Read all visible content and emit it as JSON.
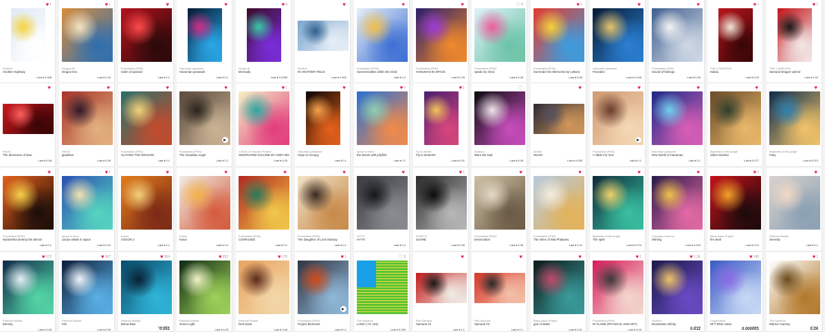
{
  "rows": [
    {
      "cards": [
        {
          "creator": "Another",
          "title": "Another Highway",
          "price": "Last ♦ 0.008",
          "likes": "1",
          "c1": "#dfe9f5",
          "c2": "#ffffff",
          "c3": "#f4d33f",
          "shape": "portrait"
        },
        {
          "creator": "Dragon Art",
          "title": "Dragon Era",
          "price": "Last ♦ 0.18",
          "likes": "1",
          "c1": "#d98c3b",
          "c2": "#2f6fb0",
          "c3": "#f4e3c2",
          "shape": "square"
        },
        {
          "creator": "Foundation (PHD)",
          "title": "realm of passion",
          "price": "Last ♦ 0.1",
          "likes": "",
          "c1": "#b3121d",
          "c2": "#2a0a0a",
          "c3": "#ff4b4b",
          "shape": "square"
        },
        {
          "creator": "Hanuman panasant",
          "title": "Hanuman panasant",
          "price": "Last ♦ 0.1",
          "likes": "",
          "c1": "#071a33",
          "c2": "#2aa7e8",
          "c3": "#d12e8b",
          "shape": "portrait"
        },
        {
          "creator": "Oracle III",
          "title": "McGrady",
          "price": "Last ♦ 0.0289",
          "likes": "8",
          "c1": "#3a0d2b",
          "c2": "#7a2dd9",
          "c3": "#39c9a8",
          "shape": "portrait"
        },
        {
          "creator": "Another",
          "title": "IN ANOTHER FIELD",
          "price": "Last ♦ 0.002",
          "likes": "",
          "c1": "#7da7cf",
          "c2": "#e6eef6",
          "c3": "#2f5f8e",
          "shape": "landscape"
        },
        {
          "creator": "Foundation (PHD)",
          "title": "Summersalties within the mind",
          "price": "Last ♦ 0.2",
          "likes": "",
          "c1": "#e6eef8",
          "c2": "#3d6fd3",
          "c3": "#f2c04e",
          "shape": "square"
        },
        {
          "creator": "Foundation (PHD)",
          "title": "HANUMAN IN SPACE",
          "price": "Last ♦ 0.25",
          "likes": "",
          "c1": "#2b1e6b",
          "c2": "#f08a2b",
          "c3": "#9f3cd8",
          "shape": "square"
        },
        {
          "creator": "Foundation (PHD)",
          "title": "speak my mind",
          "price": "Last ♦ 0.05",
          "likes": "0",
          "c1": "#dff1f8",
          "c2": "#6bc3a6",
          "c3": "#e95d9a",
          "shape": "square",
          "emptyHeart": true
        },
        {
          "creator": "Foundation (PHD)",
          "title": "Surrender the Memories by LeBora",
          "price": "Last ♦ 0.05",
          "likes": "1",
          "c1": "#e63a2c",
          "c2": "#3b9de0",
          "c3": "#f5d23a",
          "shape": "square"
        },
        {
          "creator": "Hanuman panasant",
          "title": "Poseidon",
          "price": "Last ♦ 0.045",
          "likes": "",
          "c1": "#061a33",
          "c2": "#2b7fd3",
          "c3": "#e7c36a",
          "shape": "square"
        },
        {
          "creator": "Foundation (PHD)",
          "title": "Sound of feelings",
          "price": "Last ♦ 0.05",
          "likes": "",
          "c1": "#3f5f8f",
          "c2": "#cfd8e6",
          "c3": "#f4f4f4",
          "shape": "square"
        },
        {
          "creator": "THE_LIVARGON",
          "title": "Kakau",
          "price": "Last ♦ 0.02",
          "likes": "1",
          "c1": "#b9151b",
          "c2": "#3a0608",
          "c3": "#f0e6d8",
          "shape": "portrait"
        },
        {
          "creator": "THE_LIVARGON",
          "title": "Samurai Dragon warrior",
          "price": "Last ♦ 0.02",
          "likes": "1",
          "c1": "#c4141a",
          "c2": "#f3e8e8",
          "c3": "#1a1a1a",
          "shape": "portrait"
        }
      ]
    },
    {
      "cards": [
        {
          "creator": "Hell III",
          "title": "The dimension of deer",
          "price": "Last ♦ 0.08",
          "likes": "",
          "c1": "#c8171c",
          "c2": "#3a0406",
          "c3": "#ff6060",
          "shape": "landscape"
        },
        {
          "creator": "Hell III",
          "title": "giantface",
          "price": "Last ♦ 0.08",
          "likes": "",
          "c1": "#a8342a",
          "c2": "#e2b07e",
          "c3": "#2f1a2a",
          "shape": "square"
        },
        {
          "creator": "Foundation (PHD)",
          "title": "SLAYING THE DRAGON",
          "price": "Last ♦ 0.1",
          "likes": "",
          "c1": "#2b6f6a",
          "c2": "#c24b2d",
          "c3": "#f1d27a",
          "shape": "square"
        },
        {
          "creator": "Foundation (PHD)",
          "title": "The Guardian Angel",
          "price": "Last ♦ 0.1",
          "likes": "",
          "c1": "#5a4a3c",
          "c2": "#cab394",
          "c3": "#2a221c",
          "shape": "square",
          "play": true
        },
        {
          "creator": "COVID-19 Vaccine Project",
          "title": "SINOPHARM VACCINE BY ANDY MOCKARO",
          "price": "Last ♦ 0.03",
          "likes": "1",
          "c1": "#f5f0c5",
          "c2": "#e23c7c",
          "c3": "#2aa7a0",
          "shape": "square"
        },
        {
          "creator": "Hanuman panasant",
          "title": "Hope to Occupy",
          "price": "Last ♦ 0.1",
          "likes": "",
          "c1": "#0b0503",
          "c2": "#e3611c",
          "c3": "#f7a24a",
          "shape": "portrait"
        },
        {
          "creator": "space in mind",
          "title": "the dream with jellyfish",
          "price": "Last ♦ 0.1",
          "likes": "0",
          "c1": "#2b6fd3",
          "c2": "#f08a4b",
          "c3": "#8ed0b3",
          "shape": "square"
        },
        {
          "creator": "Fly to dream",
          "title": "Fly to dream#2",
          "price": "Last ♦ 0.01",
          "likes": "1",
          "c1": "#4b1f6e",
          "c2": "#d6457d",
          "c3": "#f3c45a",
          "shape": "portrait"
        },
        {
          "creator": "Amazon",
          "title": "Warn Me Dad",
          "price": "Last ♦ 0.05",
          "likes": "",
          "c1": "#0b0b0f",
          "c2": "#c84dbd",
          "c3": "#f0e6ea",
          "shape": "square",
          "emptyHeart": true
        },
        {
          "creator": "OKAM",
          "title": "OKAM",
          "price": "Last ♦ 0.005",
          "likes": "",
          "c1": "#2c2a33",
          "c2": "#d1965a",
          "c3": "#554f5f",
          "shape": "landscape"
        },
        {
          "creator": "Foundation (PHD)",
          "title": "A Table For One",
          "price": "Last ♦ 0.1",
          "likes": "",
          "c1": "#cf9a73",
          "c2": "#f4d7b4",
          "c3": "#6a3b2a",
          "shape": "square",
          "play": true
        },
        {
          "creator": "Hanuman panasant",
          "title": "New World of Hanuman",
          "price": "Last ♦ 0.1",
          "likes": "",
          "c1": "#1b2b88",
          "c2": "#d95eb6",
          "c3": "#6fd0ef",
          "shape": "square"
        },
        {
          "creator": "Mysteries of the jungle",
          "title": "Silent Gazebo",
          "price": "Last ♦ 0.077",
          "likes": "",
          "c1": "#6a4b2a",
          "c2": "#e9b76a",
          "c3": "#2f3f2b",
          "shape": "square"
        },
        {
          "creator": "Mysteries of the jungle",
          "title": "Fairy",
          "price": "Last ♦ 0.074",
          "likes": "",
          "c1": "#0d2b4b",
          "c2": "#f2c46a",
          "c3": "#2f7fb0",
          "shape": "square"
        }
      ]
    },
    {
      "cards": [
        {
          "creator": "Foundation (PHD)",
          "title": "Narasimha destroy the demon",
          "price": "Last ♦ 0.1",
          "likes": "",
          "c1": "#e6601c",
          "c2": "#1b0d08",
          "c3": "#f7d14a",
          "shape": "square"
        },
        {
          "creator": "space in mind",
          "title": "cactus whale in space",
          "price": "Last ♦ 0.10",
          "likes": "1",
          "c1": "#2b4fb3",
          "c2": "#55d5c0",
          "c3": "#f3e2b0",
          "shape": "square"
        },
        {
          "creator": "Kasso",
          "title": "AGGON 2",
          "price": "Last ♦ 0.1",
          "likes": "",
          "c1": "#e37b1c",
          "c2": "#7a2a16",
          "c3": "#f3d07a",
          "shape": "square"
        },
        {
          "creator": "Kasso",
          "title": "Kasoi",
          "price": "Last ♦ 0.2",
          "likes": "",
          "c1": "#f0ece4",
          "c2": "#d45a3c",
          "c3": "#f2b34a",
          "shape": "square"
        },
        {
          "creator": "Foundation (PHD)",
          "title": "CONFUSED",
          "price": "Last ♦ 0.1",
          "likes": "",
          "c1": "#b4261e",
          "c2": "#f1c84a",
          "c3": "#2a7a5a",
          "shape": "square"
        },
        {
          "creator": "Foundation (PHD)",
          "title": "The Daughter of Lord Varanay",
          "price": "Last ♦ 0.1",
          "likes": "",
          "c1": "#f0e2c6",
          "c2": "#c88a4a",
          "c3": "#3a2a22",
          "shape": "square"
        },
        {
          "creator": "HYTH",
          "title": "HYTH",
          "price": "Last ♦ 0.2",
          "likes": "",
          "c1": "#3a3b40",
          "c2": "#8a8c92",
          "c3": "#16171a",
          "shape": "square"
        },
        {
          "creator": "SUAR VI",
          "title": "SUARE",
          "price": "Last ♦ 0.05",
          "likes": "1",
          "c1": "#2b2b2b",
          "c2": "#b8b8b8",
          "c3": "#0c0c0c",
          "shape": "square"
        },
        {
          "creator": "Foundation (PHD)",
          "title": "Desecration",
          "price": "Last ♦ 0.35",
          "likes": "",
          "c1": "#cdbfa4",
          "c2": "#6a5a44",
          "c3": "#e4d9c6",
          "shape": "square"
        },
        {
          "creator": "Foundation (PHD)",
          "title": "The shine of Wat Phakaew",
          "price": "Last ♦ 0.11",
          "likes": "",
          "c1": "#b7c9dc",
          "c2": "#e3b25a",
          "c3": "#f4ede0",
          "shape": "square"
        },
        {
          "creator": "Mysteries of the jungle",
          "title": "The spirit",
          "price": "Last ♦ 0.074",
          "likes": "",
          "c1": "#0c2a3a",
          "c2": "#3ac0a0",
          "c3": "#f1d36a",
          "shape": "square"
        },
        {
          "creator": "Compass Cosmos",
          "title": "Shining",
          "price": "Last ♦ 0.013",
          "likes": "",
          "c1": "#2a1a4b",
          "c2": "#e46aa6",
          "c3": "#f0c24a",
          "shape": "square"
        },
        {
          "creator": "Black Asian Project",
          "title": "fire devil",
          "price": "Last ♦ 0.01",
          "likes": "2",
          "c1": "#c4131a",
          "c2": "#1c0a0c",
          "c3": "#f2a12a",
          "shape": "square"
        },
        {
          "creator": "Ethereal Worlds",
          "title": "Serenity",
          "price": "Last ♦ 0.1",
          "likes": "",
          "c1": "#d9d2ce",
          "c2": "#8aa0b3",
          "c3": "#f2d9c5",
          "shape": "square"
        }
      ]
    },
    {
      "cards": [
        {
          "creator": "Ethereal Worlds",
          "title": "Eternity",
          "price": "Last ♦ 0.05",
          "likes": "372",
          "c1": "#0f2a4a",
          "c2": "#54d6a6",
          "c3": "#e5eef6",
          "shape": "square"
        },
        {
          "creator": "Ethereal Worlds",
          "title": "ICE",
          "price": "Last ♦ 0.05",
          "likes": "367",
          "c1": "#0d1d3a",
          "c2": "#5ab0e6",
          "c3": "#f0f4f8",
          "shape": "square"
        },
        {
          "creator": "Ethereal Worlds",
          "title": "Below Blue",
          "price": "0.051",
          "likes": "364",
          "c1": "#0a4b6a",
          "c2": "#2fb4d8",
          "c3": "#0a2033",
          "shape": "square",
          "big": true,
          "plabel": "Best Offer"
        },
        {
          "creator": "Ethereal Worlds",
          "title": "Green Light",
          "price": "Last ♦ 0.05",
          "likes": "352",
          "c1": "#0e2a12",
          "c2": "#9ed25a",
          "c3": "#f0f4c6",
          "shape": "square"
        },
        {
          "creator": "Ethereal Worlds",
          "title": "Red Giant",
          "price": "Last ♦ 0.06",
          "likes": "176",
          "c1": "#e9a462",
          "c2": "#f2d7a8",
          "c3": "#5a2a1a",
          "shape": "square"
        },
        {
          "creator": "Foundation (PHD)",
          "title": "Project Elements",
          "price": "Last ♦ 0.1",
          "likes": "1",
          "c1": "#2f3442",
          "c2": "#8fb8d8",
          "c3": "#d14a1a",
          "shape": "square",
          "play": true
        },
        {
          "creator": "The Sandbox",
          "title": "LAND (-74, 151)",
          "price": "Last ♦ 0.299",
          "likes": "0",
          "c1": "#1aa0e8",
          "c2": "#5ac234",
          "c3": "#f2e14a",
          "shape": "land",
          "emptyHeart": true
        },
        {
          "creator": "Red Samurai",
          "title": "Samurai #2",
          "price": "Last ♦ 0.1",
          "likes": "",
          "c1": "#c41a1a",
          "c2": "#f0ece6",
          "c3": "#1a1a1a",
          "shape": "landscape"
        },
        {
          "creator": "Red Samurai",
          "title": "Samurai #2",
          "price": "Last ♦ 0.1",
          "likes": "",
          "c1": "#d8362a",
          "c2": "#f3c0a8",
          "c3": "#2a2a2a",
          "shape": "landscape"
        },
        {
          "creator": "Black Asian Project",
          "title": "god of death",
          "price": "Last ♦ 0.01",
          "likes": "",
          "c1": "#0d1a1a",
          "c2": "#3a9a9a",
          "c3": "#c14a6a",
          "shape": "square"
        },
        {
          "creator": "Foundation (PHD)",
          "title": "IN FLAME (PHYSICAL AND NFT)",
          "price": "Last ♦ 0.05",
          "likes": "1",
          "c1": "#d91a5a",
          "c2": "#f4d8cf",
          "c3": "#3a3a3a",
          "shape": "square"
        },
        {
          "creator": "GridFun",
          "title": "Destination Infinity",
          "price": "0.012",
          "likes": "1.1K",
          "c1": "#1a1a4a",
          "c2": "#6a4ac4",
          "c3": "#f0c46a",
          "shape": "square",
          "big": true,
          "plabel": "Price"
        },
        {
          "creator": "CryptoTanks",
          "title": "NFT Ether token",
          "price": "0.000001",
          "likes": "145",
          "c1": "#3a5ac4",
          "c2": "#c8d9f6",
          "c3": "#8a6ae6",
          "shape": "square",
          "big": true,
          "plabel": "Price"
        },
        {
          "creator": "The Sandbox",
          "title": "Warrior mummy",
          "price": "0.24",
          "likes": "1",
          "c1": "#ffffff",
          "c2": "#b2782a",
          "c3": "#6a4a1a",
          "shape": "square",
          "big": true,
          "plabel": "Price"
        }
      ]
    }
  ]
}
